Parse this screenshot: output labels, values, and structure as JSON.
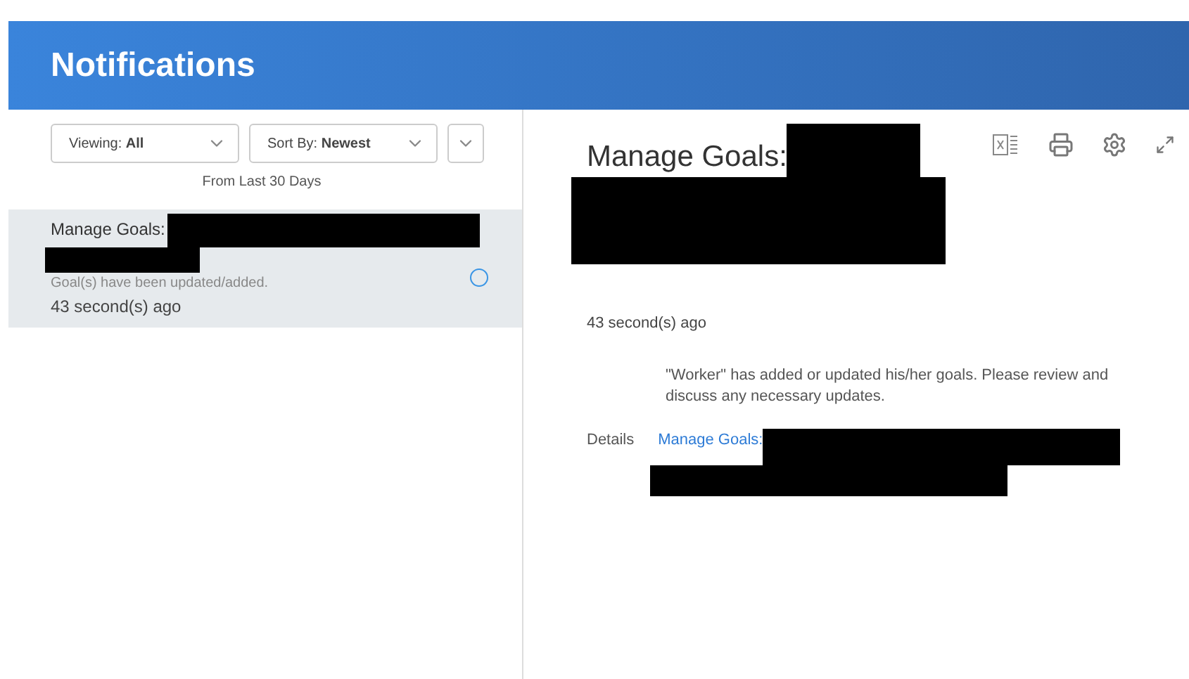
{
  "header": {
    "title": "Notifications"
  },
  "filters": [
    {
      "label": "Viewing:",
      "value": "All"
    },
    {
      "label": "Sort By:",
      "value": "Newest"
    }
  ],
  "range_note": "From Last 30 Days",
  "notifications": [
    {
      "title": "Manage Goals:",
      "message": "Goal(s) have been updated/added.",
      "time": "43 second(s) ago",
      "selected": true,
      "unread": true
    }
  ],
  "detail": {
    "title": "Manage Goals:",
    "time": "43 second(s) ago",
    "body": "\"Worker\" has added or updated his/her goals. Please review and discuss any necessary updates.",
    "details_label": "Details",
    "details_link": "Manage Goals:"
  }
}
